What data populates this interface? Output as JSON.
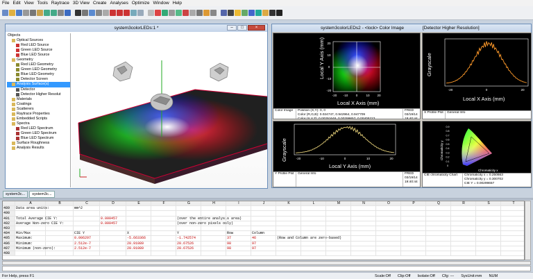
{
  "menu": [
    "File",
    "Edit",
    "View",
    "Tools",
    "Raytrace",
    "3D View",
    "Create",
    "Analyses",
    "Optimize",
    "Window",
    "Help"
  ],
  "toolbar_icons": [
    "new-icon",
    "open-icon",
    "save-icon",
    "cut-icon",
    "copy-icon",
    "paste-icon",
    "undo-icon",
    "redo-icon",
    "print-icon",
    "help-icon",
    "select-icon",
    "rotate-icon",
    "zoom-icon",
    "pan-icon",
    "grid-icon",
    "ray-icon",
    "trace-icon",
    "source-icon",
    "lens-icon",
    "mirror-icon",
    "prism-icon",
    "spectrum-icon",
    "chart-icon",
    "table-icon",
    "cube-icon",
    "axis-icon",
    "lock-icon",
    "measure-icon",
    "optimize-icon",
    "script-icon",
    "layers-icon",
    "camera-icon",
    "light-icon",
    "filter-icon",
    "info-icon",
    "export-icon",
    "folder-icon",
    "star-icon",
    "pointer-icon"
  ],
  "doc_window": {
    "title": "system3colorLEDs:1 *",
    "tree": [
      {
        "label": "Objects",
        "level": 0,
        "icon": ""
      },
      {
        "label": "Optical Sources",
        "level": 1,
        "icon": "#d9b85c"
      },
      {
        "label": "Red LED Source",
        "level": 2,
        "icon": "#cc3333"
      },
      {
        "label": "Green LED Source",
        "level": 2,
        "icon": "#cc3333"
      },
      {
        "label": "Blue LED Source",
        "level": 2,
        "icon": "#cc3333"
      },
      {
        "label": "Geometry",
        "level": 1,
        "icon": "#d9b85c"
      },
      {
        "label": "Red LED Geometry",
        "level": 2,
        "icon": "#8a8a30"
      },
      {
        "label": "Green LED Geometry",
        "level": 2,
        "icon": "#8a8a30"
      },
      {
        "label": "Blue LED Geometry",
        "level": 2,
        "icon": "#8a8a30"
      },
      {
        "label": "Detector Screen",
        "level": 2,
        "icon": "#8a8a30"
      },
      {
        "label": "Analysis Surface(s)",
        "level": 1,
        "icon": "#d9b85c",
        "selected": true
      },
      {
        "label": "Detector",
        "level": 2,
        "icon": "#555555"
      },
      {
        "label": "Detector Higher Resolut",
        "level": 2,
        "icon": "#555555"
      },
      {
        "label": "Materials",
        "level": 1,
        "icon": "#d9b85c"
      },
      {
        "label": "Coatings",
        "level": 1,
        "icon": "#d9b85c"
      },
      {
        "label": "Scatterers",
        "level": 1,
        "icon": "#d9b85c"
      },
      {
        "label": "Raytrace Properties",
        "level": 1,
        "icon": "#d9b85c"
      },
      {
        "label": "Embedded Scripts",
        "level": 1,
        "icon": "#d9b85c"
      },
      {
        "label": "Spectra",
        "level": 1,
        "icon": "#d9b85c"
      },
      {
        "label": "Red LED Spectrum",
        "level": 2,
        "icon": "#aa3333"
      },
      {
        "label": "Green LED Spectrum",
        "level": 2,
        "icon": "#aa3333"
      },
      {
        "label": "Blue LED Spectrum",
        "level": 2,
        "icon": "#aa3333"
      },
      {
        "label": "Surface Roughness",
        "level": 1,
        "icon": "#d9b85c"
      },
      {
        "label": "Analysis Results",
        "level": 1,
        "icon": "#d9b85c"
      }
    ]
  },
  "tabs": [
    "system3c...",
    "system3c..."
  ],
  "chart_window": {
    "title": "system3colorLEDs2 - <lock> Color Image",
    "title_right": "[Detector Higher Resolution]",
    "color_image": {
      "xlabel": "Local X Axis (mm)",
      "ylabel": "Local Y Axis (mm)",
      "xticks": [
        "-20",
        "-10",
        "0",
        "10",
        "20"
      ],
      "yticks": [
        "20",
        "10",
        "0",
        "-10",
        "-20"
      ],
      "info_label": "Color Image",
      "info_lines": [
        "Position (X,Y): 0, 0",
        "Color (R,G,B): 0.024747, 0.942964, 0.947709",
        "Color (X,Y,Z): 0.00291646, 0.00299657, 0.00405223"
      ],
      "stamp": [
        "FRED",
        "03/19/14",
        "19:40:44"
      ]
    },
    "x_profile": {
      "ylabel": "Grayscale",
      "xlabel": "Local X Axis (mm)",
      "xticks": [
        "-20",
        "0",
        "20"
      ],
      "label": "X Profile Plot",
      "info": "General Info"
    },
    "y_profile": {
      "ylabel": "Grayscale",
      "xlabel": "Local Y Axis (mm)",
      "xticks": [
        "-20",
        "-10",
        "0",
        "10",
        "20"
      ],
      "label": "Y Profile Plot",
      "info": "General Info",
      "stamp": [
        "FRED",
        "03/19/14",
        "19:40:44"
      ]
    },
    "cie": {
      "ylabel": "Chromaticity y",
      "xlabel": "Chromaticity x",
      "yticks": [
        "0.9",
        "0.8",
        "0.7",
        "0.6",
        "0.5",
        "0.4",
        "0.3",
        "0.2",
        "0.1",
        "0"
      ],
      "label": "CIE chromaticity Chart",
      "info_lines": [
        "Chromaticity x = 0.250663",
        "Chromaticity y = 0.300702",
        "CIE Y = 0.00299657"
      ]
    }
  },
  "grid": {
    "columns": [
      "A",
      "B",
      "C",
      "D",
      "E",
      "F",
      "G",
      "H",
      "I",
      "J",
      "K",
      "L",
      "M",
      "N",
      "O",
      "P",
      "Q",
      "R",
      "S",
      "T",
      "U",
      "V"
    ],
    "rows": [
      {
        "num": "489",
        "cells": [
          {
            "c": 0,
            "t": "Data area units:"
          },
          {
            "c": 2,
            "t": "mm^2"
          }
        ]
      },
      {
        "num": "490",
        "cells": []
      },
      {
        "num": "491",
        "cells": [
          {
            "c": 0,
            "t": "Total Average CIE Y:"
          },
          {
            "c": 3,
            "t": "0.000457",
            "red": true
          },
          {
            "c": 6,
            "t": "(over the entire analysis area)"
          }
        ]
      },
      {
        "num": "492",
        "cells": [
          {
            "c": 0,
            "t": "Average Non-zero CIE Y:"
          },
          {
            "c": 3,
            "t": "0.000457",
            "red": true
          },
          {
            "c": 6,
            "t": "(over non-zero pixels only)"
          }
        ]
      },
      {
        "num": "493",
        "cells": []
      },
      {
        "num": "494",
        "cells": [
          {
            "c": 0,
            "t": "Min/Max"
          },
          {
            "c": 2,
            "t": "CIE Y"
          },
          {
            "c": 4,
            "t": "X"
          },
          {
            "c": 6,
            "t": "Y"
          },
          {
            "c": 8,
            "t": "Row"
          },
          {
            "c": 9,
            "t": "Column"
          }
        ]
      },
      {
        "num": "495",
        "cells": [
          {
            "c": 0,
            "t": "Maximum:"
          },
          {
            "c": 2,
            "t": "0.006297",
            "red": true
          },
          {
            "c": 4,
            "t": "-5.663366",
            "red": true
          },
          {
            "c": 6,
            "t": "-1.742574",
            "red": true
          },
          {
            "c": 8,
            "t": "37",
            "red": true
          },
          {
            "c": 9,
            "t": "46",
            "red": true
          },
          {
            "c": 10,
            "t": "(Row and Column are zero-based)"
          }
        ]
      },
      {
        "num": "496",
        "cells": [
          {
            "c": 0,
            "t": "Minimum:"
          },
          {
            "c": 2,
            "t": "2.512e-7",
            "red": true
          },
          {
            "c": 4,
            "t": "20.91089",
            "red": true
          },
          {
            "c": 6,
            "t": "20.67526",
            "red": true
          },
          {
            "c": 8,
            "t": "98",
            "red": true
          },
          {
            "c": 9,
            "t": "97",
            "red": true
          }
        ]
      },
      {
        "num": "497",
        "cells": [
          {
            "c": 0,
            "t": "Minimum (non-zero):"
          },
          {
            "c": 2,
            "t": "2.512e-7",
            "red": true
          },
          {
            "c": 4,
            "t": "20.91089",
            "red": true
          },
          {
            "c": 6,
            "t": "20.67526",
            "red": true
          },
          {
            "c": 8,
            "t": "98",
            "red": true
          },
          {
            "c": 9,
            "t": "97",
            "red": true
          }
        ]
      },
      {
        "num": "498",
        "cells": []
      }
    ]
  },
  "status": {
    "left": "For Help, press F1",
    "items": [
      "Scale:Off",
      "Clip:Off",
      "Isolate:Off",
      "Cfg: ---",
      "SysUnit:mm",
      "NUM"
    ]
  }
}
